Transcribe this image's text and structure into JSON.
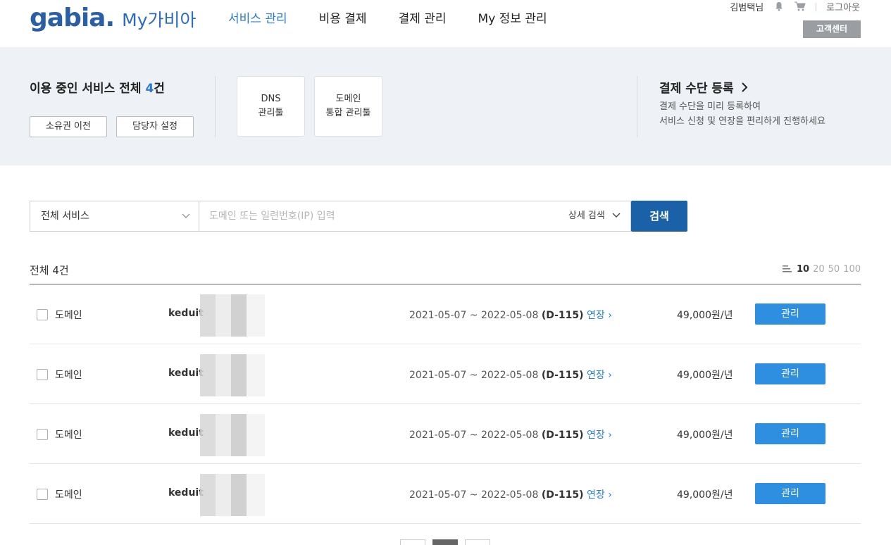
{
  "header": {
    "logo_text": "gabia",
    "logo_sub": "My가비아",
    "nav": [
      "서비스 관리",
      "비용 결제",
      "결제 관리",
      "My 정보 관리"
    ],
    "user_name": "김범택님",
    "logout": "로그아웃",
    "help_center": "고객센터"
  },
  "summary": {
    "title_prefix": "이용 중인 서비스 전체 ",
    "title_count": "4",
    "title_suffix": "건",
    "transfer_btn": "소유권 이전",
    "manager_btn": "담당자 설정",
    "tools": [
      {
        "line1": "DNS",
        "line2": "관리툴"
      },
      {
        "line1": "도메인",
        "line2": "통합 관리툴"
      }
    ],
    "payment_title": "결제 수단 등록",
    "payment_desc1": "결제 수단을 미리 등록하여",
    "payment_desc2": "서비스 신청 및 연장을 편리하게 진행하세요"
  },
  "search": {
    "select_value": "전체 서비스",
    "placeholder": "도메인 또는 일련번호(IP) 입력",
    "detail": "상세 검색",
    "button": "검색"
  },
  "list": {
    "total_label": "전체 4건",
    "page_sizes": [
      "10",
      "20",
      "50",
      "100"
    ],
    "active_page_size": "10",
    "rows": [
      {
        "type": "도메인",
        "domain": "keduit",
        "period": "2021-05-07 ~ 2022-05-08",
        "dday": "(D-115)",
        "renew": "연장",
        "price": "49,000원/년",
        "action": "관리"
      },
      {
        "type": "도메인",
        "domain": "keduit",
        "period": "2021-05-07 ~ 2022-05-08",
        "dday": "(D-115)",
        "renew": "연장",
        "price": "49,000원/년",
        "action": "관리"
      },
      {
        "type": "도메인",
        "domain": "keduit",
        "period": "2021-05-07 ~ 2022-05-08",
        "dday": "(D-115)",
        "renew": "연장",
        "price": "49,000원/년",
        "action": "관리"
      },
      {
        "type": "도메인",
        "domain": "keduit",
        "period": "2021-05-07 ~ 2022-05-08",
        "dday": "(D-115)",
        "renew": "연장",
        "price": "49,000원/년",
        "action": "관리"
      }
    ]
  },
  "colors": {
    "brand": "#2a5fa5",
    "accent": "#2a7bd0",
    "search_button": "#1b61a8",
    "manage_button": "#2e8ee0"
  }
}
